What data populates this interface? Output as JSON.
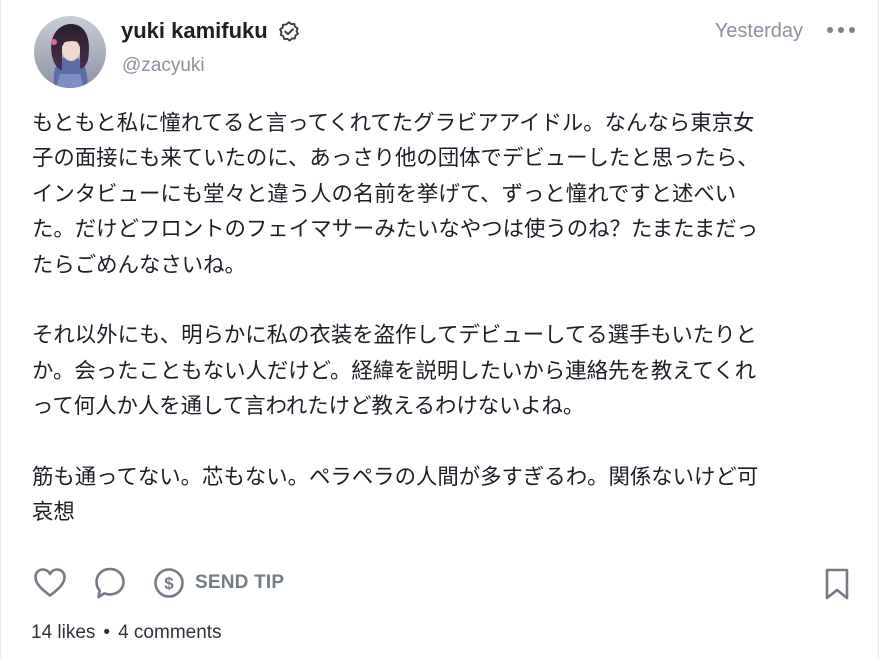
{
  "post": {
    "author": {
      "name": "yuki kamifuku",
      "handle": "@zacyuki",
      "verified": true
    },
    "timestamp": "Yesterday",
    "body": {
      "paragraphs": [
        {
          "lines": [
            "もともと私に憧れてると言ってくれてたグラビアアイドル。なんなら東京女",
            "子の面接にも来ていたのに、あっさり他の団体でデビューしたと思ったら、",
            "インタビューにも堂々と違う人の名前を挙げて、ずっと憧れですと述べい",
            "た。だけどフロントのフェイマサーみたいなやつは使うのね？たまたまだっ",
            "たらごめんなさいね。"
          ]
        },
        {
          "lines": [
            "それ以外にも、明らかに私の衣装を盗作してデビューしてる選手もいたりと",
            "か。会ったこともない人だけど。経緯を説明したいから連絡先を教えてくれ",
            "って何人か人を通して言われたけど教えるわけないよね。"
          ]
        },
        {
          "lines": [
            "筋も通ってない。芯もない。ペラペラの人間が多すぎるわ。関係ないけど可",
            "哀想"
          ]
        }
      ]
    },
    "actions": {
      "tip_label": "SEND TIP"
    },
    "stats": {
      "likes": "14 likes",
      "separator": "•",
      "comments": "4 comments"
    },
    "icons": {
      "avatar": "avatar-photo",
      "verified": "verified-badge-icon",
      "more": "more-dots-icon",
      "like": "heart-icon",
      "comment": "comment-bubble-icon",
      "tip": "dollar-coin-icon",
      "bookmark": "bookmark-icon"
    },
    "colors": {
      "text": "#1b1f27",
      "muted": "#8a929e",
      "icon": "#737b87"
    }
  }
}
